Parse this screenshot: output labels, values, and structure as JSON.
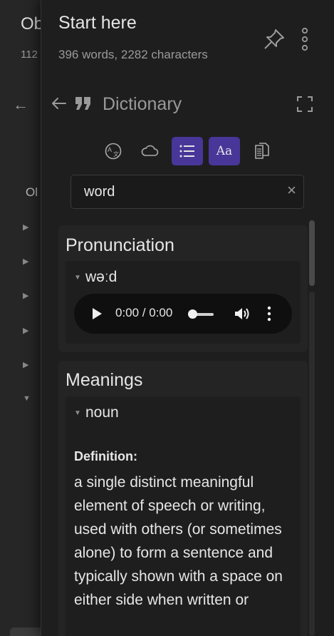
{
  "back_pane": {
    "title": "Ob",
    "subtitle": "112",
    "outline_label": "Ol"
  },
  "note": {
    "title": "Start here",
    "stats": "396 words, 2282 characters"
  },
  "view": {
    "title": "Dictionary"
  },
  "search": {
    "value": "word",
    "clear_glyph": "×"
  },
  "pronunciation": {
    "heading": "Pronunciation",
    "phonetic": "wəːd",
    "audio_time": "0:00 / 0:00"
  },
  "meanings": {
    "heading": "Meanings",
    "part_of_speech": "noun",
    "definition_label": "Definition:",
    "definition_text": "a single distinct meaningful element of speech or writing, used with others (or sometimes alone) to form a sentence and typically shown with a space on either side when written or"
  },
  "toolbar": {
    "text_size_label": "Aa",
    "icons": [
      "translate-icon",
      "cloud-icon",
      "list-icon",
      "text-size-icon",
      "copy-icon"
    ]
  },
  "colors": {
    "accent": "#483699",
    "background": "#1e1e1e",
    "card": "#242424"
  }
}
